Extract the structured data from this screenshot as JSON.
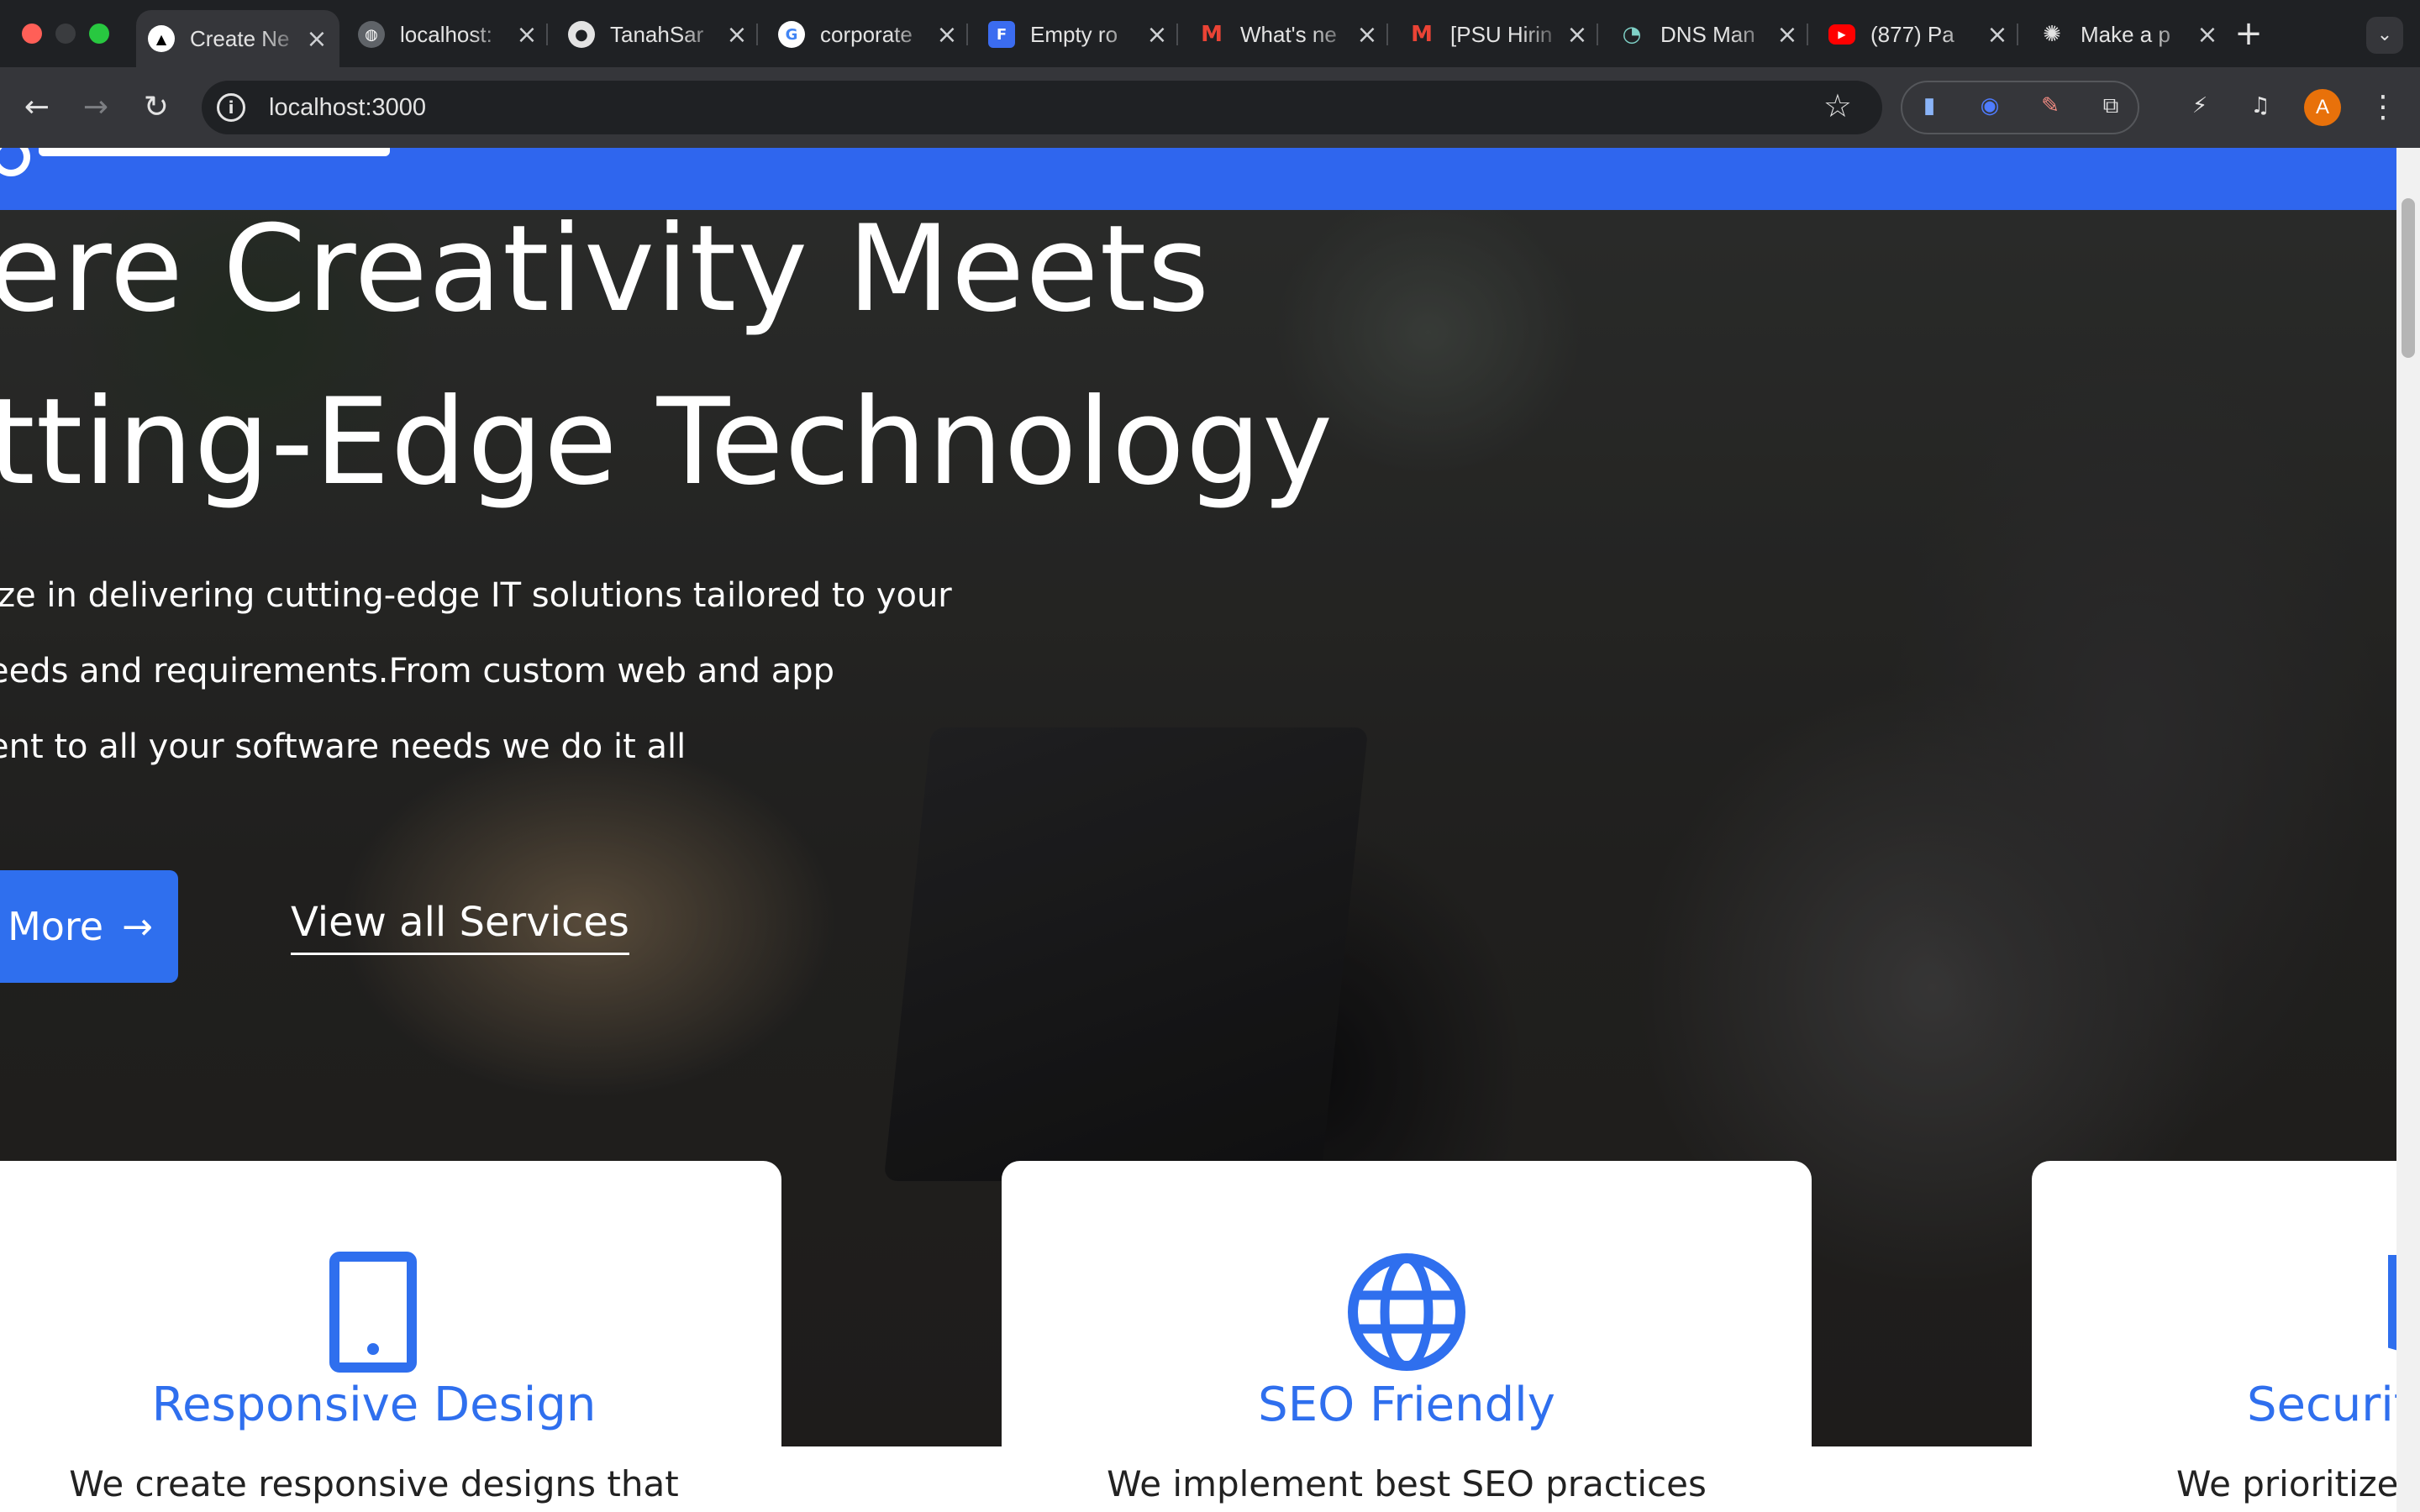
{
  "browser": {
    "tabs": [
      {
        "title": "Create Ne",
        "favicon": "triangle-logo-icon",
        "active": true
      },
      {
        "title": "localhost:",
        "favicon": "globe-icon"
      },
      {
        "title": "TanahSar",
        "favicon": "github-icon"
      },
      {
        "title": "corporate",
        "favicon": "google-icon"
      },
      {
        "title": "Empty ro",
        "favicon": "doc-icon"
      },
      {
        "title": "What's ne",
        "favicon": "gmail-icon"
      },
      {
        "title": "[PSU Hirin",
        "favicon": "gmail-icon"
      },
      {
        "title": "DNS Man",
        "favicon": "dns-icon"
      },
      {
        "title": "(877) Pa",
        "favicon": "youtube-icon"
      },
      {
        "title": "Make a p",
        "favicon": "openai-icon"
      }
    ],
    "url": "localhost:3000",
    "profile_initial": "A",
    "new_tab_label": "+",
    "colors": {
      "chrome_dark": "#1f2124",
      "chrome_toolbar": "#35363a",
      "profile": "#e8710a"
    }
  },
  "page": {
    "colors": {
      "brand_blue": "#2f66ee",
      "button_blue": "#2f6fee",
      "card_title": "#2f6fee"
    },
    "hero": {
      "headline_line1": "ere Creativity Meets",
      "headline_line2": "tting-Edge Technology",
      "lead_line1": "ize in delivering cutting-edge IT solutions tailored to your",
      "lead_line2": "eeds and requirements.From custom web and app",
      "lead_line3": "ent to all your software needs we do it all",
      "primary_button": "More",
      "secondary_link": "View all Services"
    },
    "cards": [
      {
        "title": "Responsive Design",
        "desc": "We create responsive designs that",
        "icon": "tablet-icon"
      },
      {
        "title": "SEO Friendly",
        "desc": "We implement best SEO practices",
        "icon": "globe-icon"
      },
      {
        "title": "Securit",
        "desc": "We prioritize",
        "icon": "shield-icon"
      }
    ]
  }
}
